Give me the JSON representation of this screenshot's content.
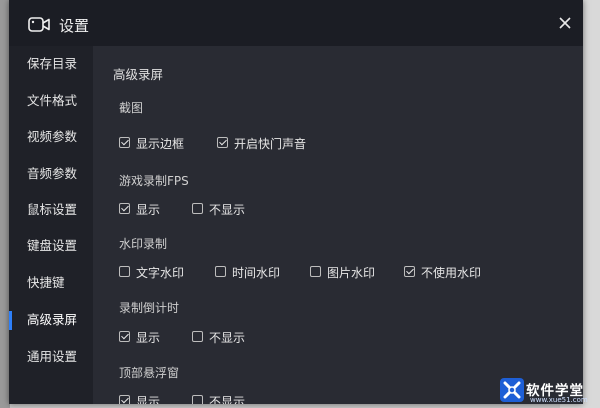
{
  "window": {
    "title": "设置",
    "title_icon": "camera-icon",
    "close_icon": "close-icon"
  },
  "sidebar": {
    "items": [
      {
        "label": "保存目录",
        "active": false
      },
      {
        "label": "文件格式",
        "active": false
      },
      {
        "label": "视频参数",
        "active": false
      },
      {
        "label": "音频参数",
        "active": false
      },
      {
        "label": "鼠标设置",
        "active": false
      },
      {
        "label": "键盘设置",
        "active": false
      },
      {
        "label": "快捷键",
        "active": false
      },
      {
        "label": "高级录屏",
        "active": true
      },
      {
        "label": "通用设置",
        "active": false
      }
    ]
  },
  "content": {
    "section_title": "高级录屏",
    "groups": [
      {
        "title": "截图",
        "options": [
          {
            "label": "显示边框",
            "checked": true
          },
          {
            "label": "开启快门声音",
            "checked": true
          }
        ]
      },
      {
        "title": "游戏录制FPS",
        "options": [
          {
            "label": "显示",
            "checked": true
          },
          {
            "label": "不显示",
            "checked": false
          }
        ]
      },
      {
        "title": "水印录制",
        "options": [
          {
            "label": "文字水印",
            "checked": false
          },
          {
            "label": "时间水印",
            "checked": false
          },
          {
            "label": "图片水印",
            "checked": false
          },
          {
            "label": "不使用水印",
            "checked": true
          }
        ]
      },
      {
        "title": "录制倒计时",
        "options": [
          {
            "label": "显示",
            "checked": true
          },
          {
            "label": "不显示",
            "checked": false
          }
        ]
      },
      {
        "title": "顶部悬浮窗",
        "options": [
          {
            "label": "显示",
            "checked": true
          },
          {
            "label": "不显示",
            "checked": false
          }
        ]
      }
    ]
  },
  "watermark_logo": {
    "text": "软件学堂",
    "url": "www.xue51.com"
  },
  "colors": {
    "dialog_bg": "#1b1d24",
    "content_bg": "#292b33",
    "accent": "#2d7ff9"
  }
}
